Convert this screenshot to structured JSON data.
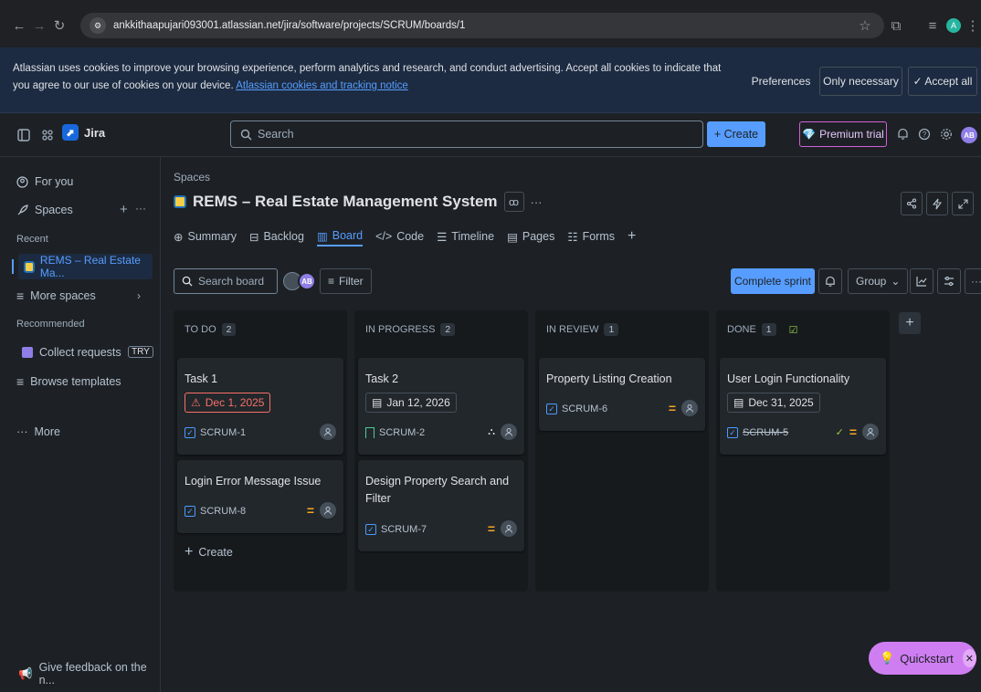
{
  "browser": {
    "url": "ankkithaapujari093001.atlassian.net/jira/software/projects/SCRUM/boards/1",
    "profile_initial": "A"
  },
  "cookie": {
    "message": "Atlassian uses cookies to improve your browsing experience, perform analytics and research, and conduct advertising. Accept all cookies to indicate that you agree to our use of cookies on your device.",
    "link": "Atlassian cookies and tracking notice",
    "preferences": "Preferences",
    "only_necessary": "Only necessary",
    "accept_all": "✓ Accept all"
  },
  "topnav": {
    "app_name": "Jira",
    "search_placeholder": "Search",
    "create": "+ Create",
    "premium": "Premium trial",
    "avatar": "AB"
  },
  "sidebar": {
    "for_you": "For you",
    "spaces": "Spaces",
    "recent_label": "Recent",
    "recent_project": "REMS – Real Estate Ma...",
    "more_spaces": "More spaces",
    "recommended_label": "Recommended",
    "collect_requests": "Collect requests",
    "try_badge": "TRY",
    "browse_templates": "Browse templates",
    "more": "More",
    "feedback": "Give feedback on the n..."
  },
  "page": {
    "breadcrumb": "Spaces",
    "title": "REMS – Real Estate Management System",
    "tabs": [
      "Summary",
      "Backlog",
      "Board",
      "Code",
      "Timeline",
      "Pages",
      "Forms"
    ]
  },
  "toolbar": {
    "search_placeholder": "Search board",
    "avatar": "AB",
    "filter": "Filter",
    "complete_sprint": "Complete sprint",
    "group": "Group"
  },
  "columns": [
    {
      "name": "TO DO",
      "count": "2"
    },
    {
      "name": "IN PROGRESS",
      "count": "2"
    },
    {
      "name": "IN REVIEW",
      "count": "1"
    },
    {
      "name": "DONE",
      "count": "1"
    }
  ],
  "cards": {
    "task1": {
      "title": "Task 1",
      "date": "Dec 1, 2025",
      "key": "SCRUM-1"
    },
    "task8": {
      "title": "Login Error Message Issue",
      "key": "SCRUM-8"
    },
    "task2": {
      "title": "Task 2",
      "date": "Jan 12, 2026",
      "key": "SCRUM-2"
    },
    "task7": {
      "title": "Design Property Search and Filter",
      "key": "SCRUM-7"
    },
    "task6": {
      "title": "Property Listing Creation",
      "key": "SCRUM-6"
    },
    "task5": {
      "title": "User Login Functionality",
      "date": "Dec 31, 2025",
      "key": "SCRUM-5"
    }
  },
  "create_label": "Create",
  "quickstart": "Quickstart",
  "colors": {
    "accent": "#579dff",
    "overdue": "#f87168",
    "priority_medium": "#f5a623",
    "premium": "#d25fd9",
    "quickstart": "#cf7ef2"
  }
}
